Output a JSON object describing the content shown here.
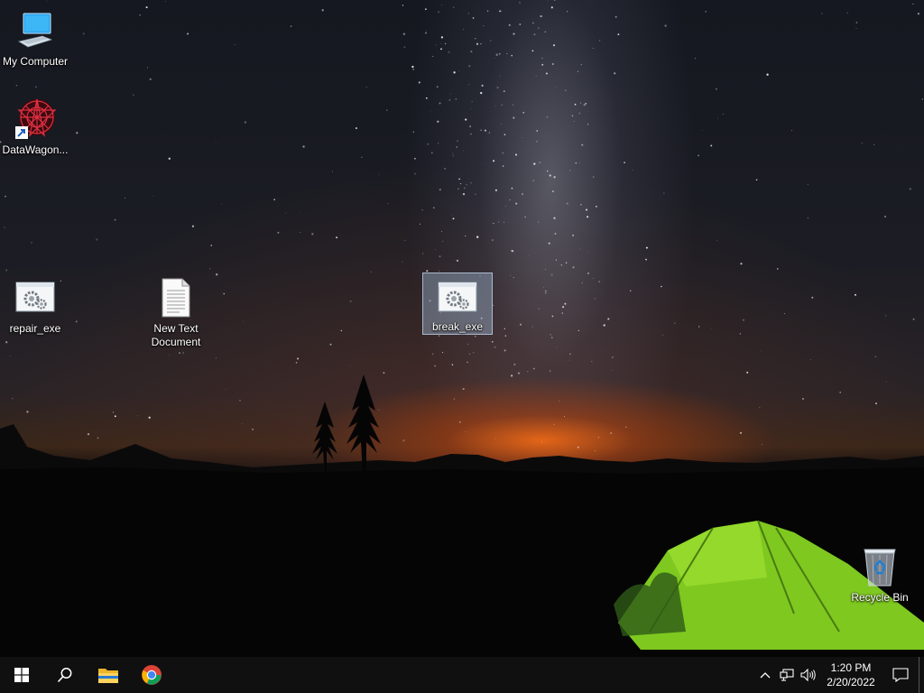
{
  "desktop": {
    "icons": [
      {
        "label": "My Computer"
      },
      {
        "label": "DataWagon..."
      },
      {
        "label": "repair_exe"
      },
      {
        "label": "New Text Document"
      },
      {
        "label": "break_exe"
      },
      {
        "label": "Recycle Bin"
      }
    ]
  },
  "taskbar": {
    "start_icon": "windows-logo-icon",
    "search_icon": "search-icon",
    "pinned": [
      {
        "icon": "file-explorer-icon"
      },
      {
        "icon": "chrome-icon"
      }
    ],
    "tray": {
      "time": "1:20 PM",
      "date": "2/20/2022"
    }
  },
  "colors": {
    "taskbar": "#101010",
    "selection": "#aac8e6",
    "tent": "#7ec820"
  }
}
